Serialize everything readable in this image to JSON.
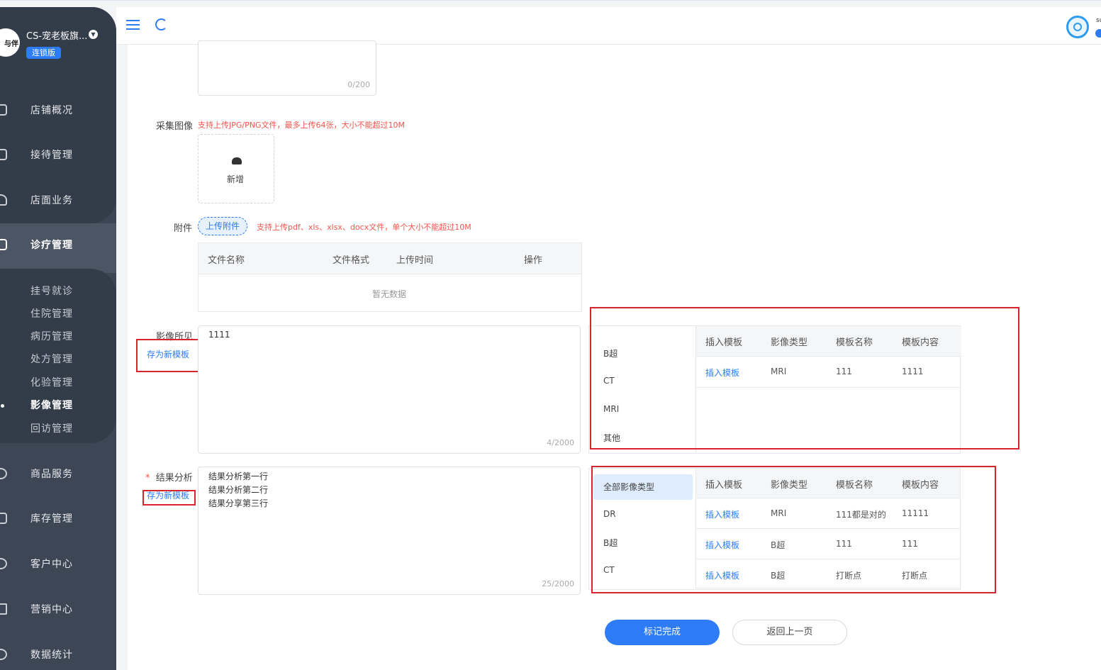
{
  "sidebar": {
    "logo_text": "与伴",
    "store_name": "CS-宠老板旗...",
    "store_badge": "连锁版",
    "items": [
      {
        "label": "店铺概况"
      },
      {
        "label": "接待管理"
      },
      {
        "label": "店面业务"
      },
      {
        "label": "诊疗管理"
      },
      {
        "label": "商品服务"
      },
      {
        "label": "库存管理"
      },
      {
        "label": "客户中心"
      },
      {
        "label": "营销中心"
      },
      {
        "label": "数据统计"
      }
    ],
    "sub_items": [
      {
        "label": "挂号就诊"
      },
      {
        "label": "住院管理"
      },
      {
        "label": "病历管理"
      },
      {
        "label": "处方管理"
      },
      {
        "label": "化验管理"
      },
      {
        "label": "影像管理"
      },
      {
        "label": "回访管理"
      }
    ]
  },
  "header": {
    "user_name_partial": "su"
  },
  "form": {
    "top_counter": "0/200",
    "image_label": "采集图像",
    "image_hint": "支持上传JPG/PNG文件，最多上传64张，大小不能超过10M",
    "image_add": "新增",
    "attachment_label": "附件",
    "attachment_button": "上传附件",
    "attachment_hint": "支持上传pdf、xls、xlsx、docx文件，单个大小不能超过10M",
    "file_table": {
      "columns": [
        "文件名称",
        "文件格式",
        "上传时间",
        "操作"
      ],
      "empty": "暂无数据"
    },
    "findings": {
      "label": "影像所见",
      "save_template": "存为新模板",
      "value": "1111",
      "counter": "4/2000"
    },
    "analysis": {
      "required_mark": "*",
      "label": "结果分析",
      "save_template": "存为新模板",
      "lines": [
        "结果分析第一行",
        "结果分析第二行",
        "结果分享第三行"
      ],
      "counter": "25/2000"
    }
  },
  "template_panel_1": {
    "categories": [
      "B超",
      "CT",
      "MRI",
      "其他"
    ],
    "columns": [
      "插入模板",
      "影像类型",
      "模板名称",
      "模板内容"
    ],
    "rows": [
      {
        "action": "插入模板",
        "type": "MRI",
        "name": "111",
        "content": "1111"
      }
    ]
  },
  "template_panel_2": {
    "categories": [
      "全部影像类型",
      "DR",
      "B超",
      "CT"
    ],
    "columns": [
      "插入模板",
      "影像类型",
      "模板名称",
      "模板内容"
    ],
    "rows": [
      {
        "action": "插入模板",
        "type": "MRI",
        "name": "111都是对的",
        "content": "11111"
      },
      {
        "action": "插入模板",
        "type": "B超",
        "name": "111",
        "content": "111"
      },
      {
        "action": "插入模板",
        "type": "B超",
        "name": "打断点",
        "content": "打断点"
      }
    ]
  },
  "actions": {
    "complete": "标记完成",
    "back": "返回上一页"
  },
  "colors": {
    "sidebar": "#3d4654",
    "accent": "#2d7cf6",
    "hint": "#f0554b",
    "annotation": "#d9232f"
  }
}
